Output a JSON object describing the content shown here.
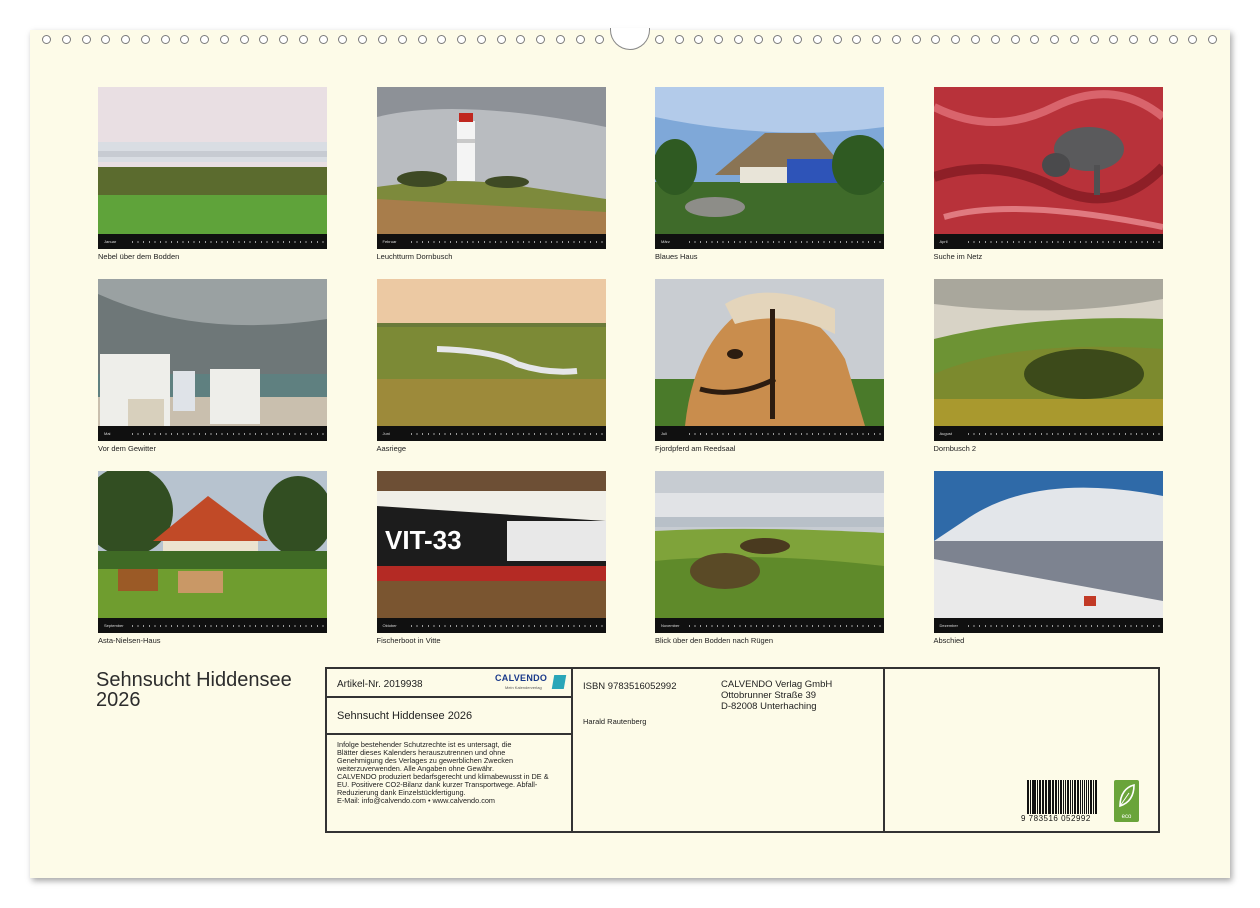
{
  "calendar": {
    "title_line1": "Sehnsucht Hiddensee",
    "title_line2": "2026",
    "months": [
      {
        "month": "Januar",
        "caption": "Nebel über dem Bodden",
        "scene": "fog-marsh"
      },
      {
        "month": "Februar",
        "caption": "Leuchtturm Dornbusch",
        "scene": "lighthouse"
      },
      {
        "month": "März",
        "caption": "Blaues Haus",
        "scene": "blue-house"
      },
      {
        "month": "April",
        "caption": "Suche im Netz",
        "scene": "cat-net"
      },
      {
        "month": "Mai",
        "caption": "Vor dem Gewitter",
        "scene": "beach-chairs"
      },
      {
        "month": "Juni",
        "caption": "Aasriege",
        "scene": "marsh-stream"
      },
      {
        "month": "Juli",
        "caption": "Fjordpferd am Reedsaal",
        "scene": "horse"
      },
      {
        "month": "August",
        "caption": "Dornbusch 2",
        "scene": "hills"
      },
      {
        "month": "September",
        "caption": "Asta-Nielsen-Haus",
        "scene": "red-house-horses"
      },
      {
        "month": "Oktober",
        "caption": "Fischerboot in Vitte",
        "scene": "fishing-boat"
      },
      {
        "month": "November",
        "caption": "Blick über den Bodden nach Rügen",
        "scene": "bodden-view"
      },
      {
        "month": "Dezember",
        "caption": "Abschied",
        "scene": "ferry"
      }
    ],
    "boat_text": "VIT-33"
  },
  "info": {
    "artikel": "Artikel-Nr. 2019938",
    "logo_word": "CALVENDO",
    "logo_tag": "Mein Kalenderverlag",
    "subtitle": "Sehnsucht Hiddensee 2026",
    "legal": [
      "Infolge bestehender Schutzrechte ist es untersagt, die",
      "Blätter dieses Kalenders herauszutrennen und ohne",
      "Genehmigung des Verlages zu gewerblichen Zwecken",
      "weiterzuverwenden. Alle Angaben ohne Gewähr.",
      "CALVENDO produziert bedarfsgerecht und klimabewusst in DE &",
      "EU. Positivere CO2-Bilanz dank kurzer Transportwege. Abfall-",
      "Reduzierung dank Einzelstückfertigung.",
      "E-Mail: info@calvendo.com • www.calvendo.com"
    ],
    "isbn": "ISBN 9783516052992",
    "author": "Harald Rautenberg",
    "publisher": [
      "CALVENDO Verlag GmbH",
      "Ottobrunner Straße 39",
      "D-82008 Unterhaching"
    ],
    "barcode_number": "9 783516 052992",
    "eco_label": "eco"
  },
  "colors": {
    "paper": "#fdfbe8",
    "eco_green": "#6aa43a",
    "calvendo_blue": "#1a3a8a"
  }
}
